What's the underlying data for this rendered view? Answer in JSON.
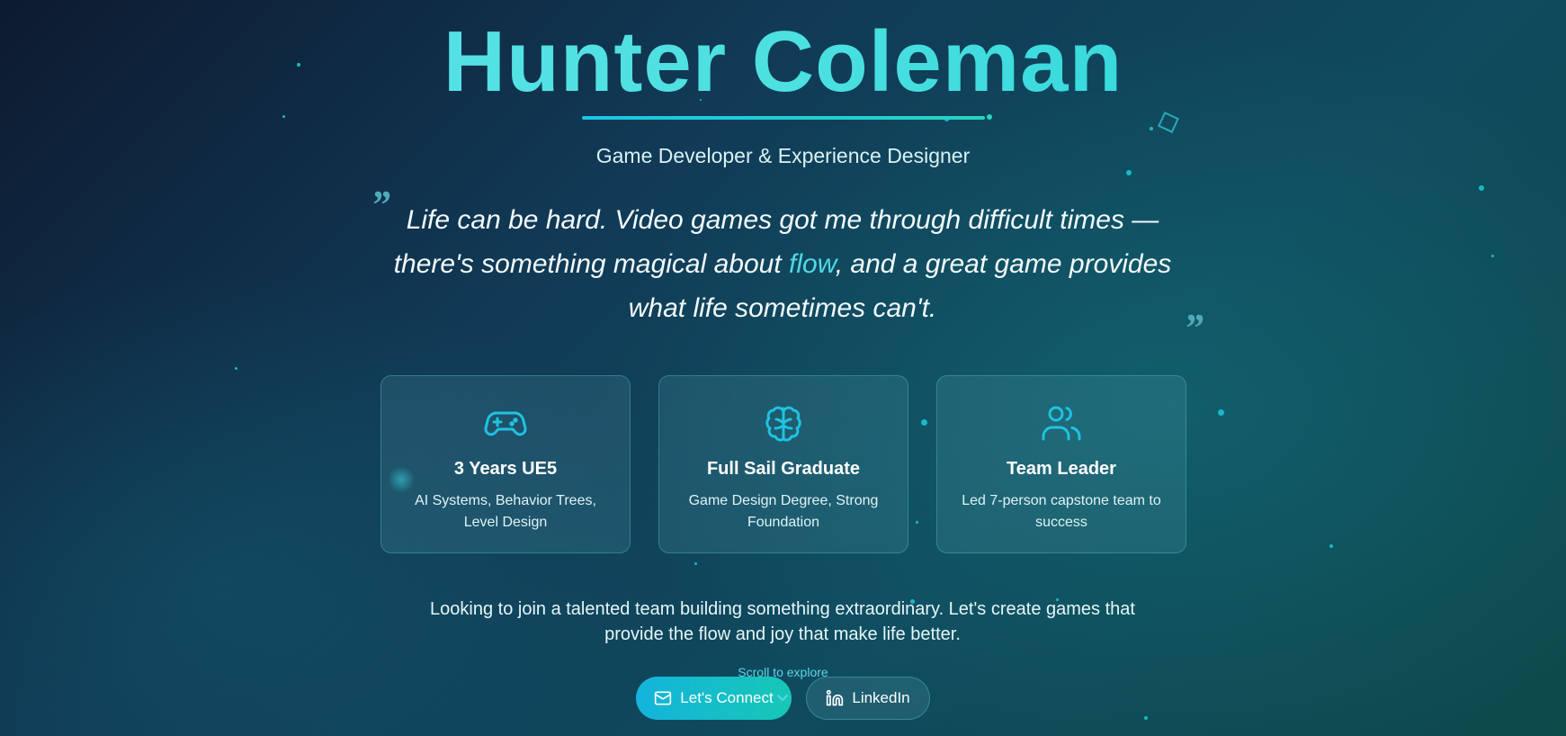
{
  "hero": {
    "name": "Hunter Coleman",
    "subtitle": "Game Developer & Experience Designer"
  },
  "quote": {
    "open_mark": "”",
    "close_mark": "”",
    "part1": "Life can be hard. Video games got me through difficult times — there's something magical about ",
    "highlight": "flow",
    "part2": ", and a great game provides what life sometimes can't."
  },
  "cards": [
    {
      "icon": "gamepad-icon",
      "title": "3 Years UE5",
      "desc": "AI Systems, Behavior Trees, Level Design"
    },
    {
      "icon": "brain-icon",
      "title": "Full Sail Graduate",
      "desc": "Game Design Degree, Strong Foundation"
    },
    {
      "icon": "users-icon",
      "title": "Team Leader",
      "desc": "Led 7-person capstone team to success"
    }
  ],
  "pitch": "Looking to join a talented team building something extraordinary. Let's create games that provide the flow and joy that make life better.",
  "scroll_hint": "Scroll to explore",
  "buttons": {
    "connect": {
      "label": "Let's Connect",
      "icon": "mail-icon"
    },
    "linkedin": {
      "label": "LinkedIn",
      "icon": "linkedin-icon"
    }
  },
  "colors": {
    "accent": "#4fd9e6",
    "gradient_start": "#14b4dc",
    "gradient_end": "#17c7b5"
  }
}
